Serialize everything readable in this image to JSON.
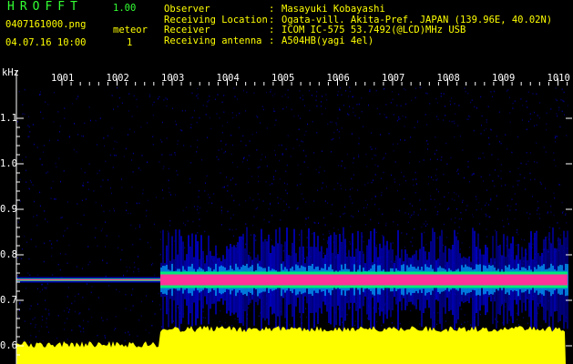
{
  "header": {
    "title": "HROFFT",
    "version": "1.00",
    "filename": "0407161000.png",
    "meteor_label": "meteor",
    "datetime": "04.07.16 10:00",
    "meteor_count": "1"
  },
  "info": {
    "separator": ":",
    "rows": [
      {
        "label": "Observer",
        "value": "Masayuki Kobayashi"
      },
      {
        "label": "Receiving Location",
        "value": "Ogata-vill. Akita-Pref. JAPAN (139.96E, 40.02N)"
      },
      {
        "label": "Receiver",
        "value": "ICOM IC-575 53.7492(@LCD)MHz USB"
      },
      {
        "label": "Receiving antenna",
        "value": "A504HB(yagi 4el)"
      }
    ]
  },
  "chart_data": {
    "type": "heatmap",
    "ylabel": "kHz",
    "y_ticks": [
      "1.1",
      "1.0",
      "0.9",
      "0.8",
      "0.7",
      "0.6"
    ],
    "y_tick_values": [
      1.1,
      1.0,
      0.9,
      0.8,
      0.7,
      0.6
    ],
    "x_ticks": [
      "1001",
      "1002",
      "1003",
      "1004",
      "1005",
      "1006",
      "1007",
      "1008",
      "1009",
      "1010"
    ],
    "ylim": [
      0.58,
      1.17
    ],
    "signal_band_khz": [
      0.73,
      0.76
    ],
    "colors": {
      "background": "#000000",
      "noise": "#0000cc",
      "signal_core": "#ff3399",
      "signal_edge": "#00ff66",
      "level_fill": "#ffff00",
      "ticks": "#ffffff"
    }
  }
}
